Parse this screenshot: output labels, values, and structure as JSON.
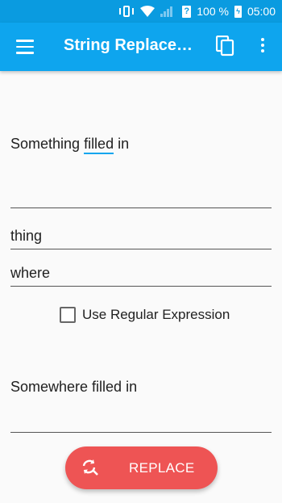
{
  "status_bar": {
    "battery": "100 %",
    "time": "05:00",
    "icons": [
      "vibrate-icon",
      "wifi-icon",
      "signal-icon",
      "sim-icon",
      "battery-icon"
    ]
  },
  "app_bar": {
    "title": "String Replace…",
    "icons": [
      "menu-icon",
      "copy-icon",
      "overflow-menu-icon"
    ],
    "color": "#0ea5ee"
  },
  "input": {
    "before": "Something ",
    "word": "filled",
    "after": " in"
  },
  "find_field": {
    "value": "thing"
  },
  "replace_field": {
    "value": "where"
  },
  "regex": {
    "label": "Use Regular Expression",
    "checked": false
  },
  "result": {
    "value": "Somewhere filled in"
  },
  "replace_button": {
    "label": "REPLACE",
    "icon": "replace-icon",
    "color": "#ee5454"
  }
}
